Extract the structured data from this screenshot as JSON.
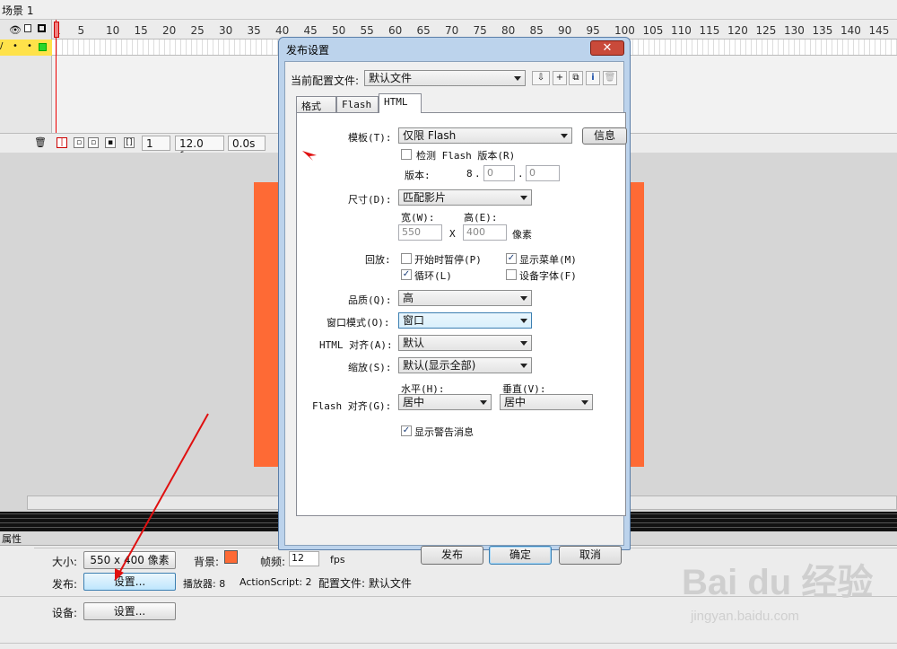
{
  "scene": {
    "title": "场景 1"
  },
  "timeline": {
    "ruler": [
      "1",
      "5",
      "10",
      "15",
      "20",
      "25",
      "30",
      "35",
      "40",
      "45",
      "50",
      "55",
      "60",
      "65",
      "70",
      "75",
      "80",
      "85",
      "90",
      "95",
      "100",
      "105",
      "110",
      "115",
      "120",
      "125",
      "130",
      "135",
      "140",
      "145"
    ],
    "frame": "1",
    "fps": "12.0 fps",
    "time": "0.0s"
  },
  "properties": {
    "header": "属性",
    "size_label": "大小:",
    "size_value": "550 x 400 像素",
    "bg_label": "背景:",
    "bg_color": "#fe6a35",
    "fps_label": "帧频:",
    "fps_value": "12",
    "fps_unit": "fps",
    "publish_label": "发布:",
    "settings_btn": "设置...",
    "player": "播放器: 8",
    "actionscript": "ActionScript: 2",
    "profile": "配置文件: 默认文件",
    "device_label": "设备:",
    "device_btn": "设置..."
  },
  "dialog": {
    "title": "发布设置",
    "close": "✕",
    "profile_label": "当前配置文件:",
    "profile_value": "默认文件",
    "tabs": [
      "格式",
      "Flash",
      "HTML"
    ],
    "template_label": "模板(T):",
    "template_value": "仅限 Flash",
    "info_btn": "信息",
    "detect_label": "检测 Flash 版本(R)",
    "version_label": "版本:",
    "version_major": "8",
    "version_minor": "0",
    "version_rev": "0",
    "dimensions_label": "尺寸(D):",
    "dimensions_value": "匹配影片",
    "width_label": "宽(W):",
    "height_label": "高(E):",
    "width_value": "550",
    "height_value": "400",
    "x_label": "X",
    "pixels_label": "像素",
    "playback_label": "回放:",
    "pause_start": "开始时暂停(P)",
    "show_menu": "显示菜单(M)",
    "loop": "循环(L)",
    "device_font": "设备字体(F)",
    "quality_label": "品质(Q):",
    "quality_value": "高",
    "window_mode_label": "窗口模式(O):",
    "window_mode_value": "窗口",
    "html_align_label": "HTML 对齐(A):",
    "html_align_value": "默认",
    "scale_label": "缩放(S):",
    "scale_value": "默认(显示全部)",
    "flash_align_label": "Flash 对齐(G):",
    "horizontal_label": "水平(H):",
    "vertical_label": "垂直(V):",
    "horizontal_value": "居中",
    "vertical_value": "居中",
    "show_warnings": "显示警告消息",
    "publish_btn": "发布",
    "ok_btn": "确定",
    "cancel_btn": "取消",
    "checks": {
      "detect": false,
      "pause_start": false,
      "show_menu": true,
      "loop": true,
      "device_font": false,
      "show_warnings": true
    }
  },
  "colors": {
    "stage": "#fe6a35",
    "annotation_arrow": "#e01010"
  },
  "watermark": {
    "logo": "Bai du 经验",
    "url": "jingyan.baidu.com"
  }
}
